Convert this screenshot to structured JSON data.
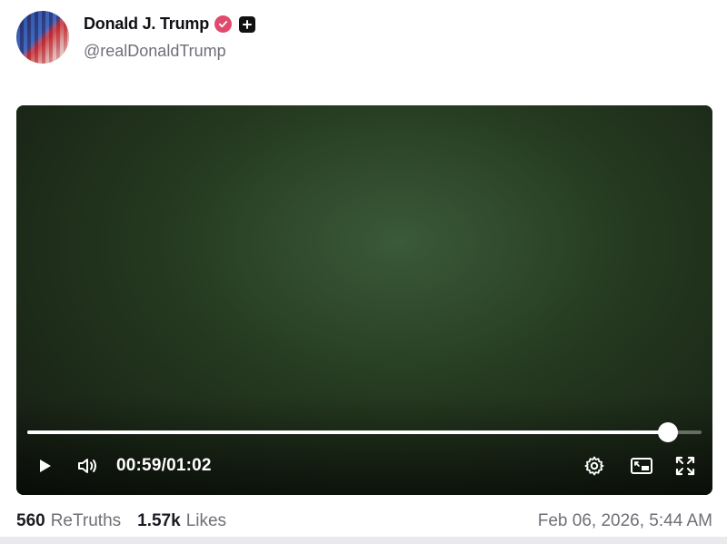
{
  "post": {
    "display_name": "Donald J. Trump",
    "handle": "@realDonaldTrump",
    "verified_icon": "verified-badge-icon",
    "plus_icon": "plus-icon"
  },
  "video": {
    "current_time": "00:59",
    "duration": "01:02",
    "time_display": "00:59/01:02",
    "progress": 0.95,
    "state": "paused",
    "controls": {
      "play": "play-icon",
      "volume": "volume-icon",
      "settings": "gear-icon",
      "pip": "picture-in-picture-icon",
      "fullscreen": "fullscreen-icon"
    }
  },
  "stats": {
    "retruths_count": "560",
    "retruths_label": "ReTruths",
    "likes_count": "1.57k",
    "likes_label": "Likes",
    "timestamp": "Feb 06, 2026, 5:44 AM"
  },
  "colors": {
    "verified": "#e14a6b",
    "muted_text": "#6f6f78"
  }
}
